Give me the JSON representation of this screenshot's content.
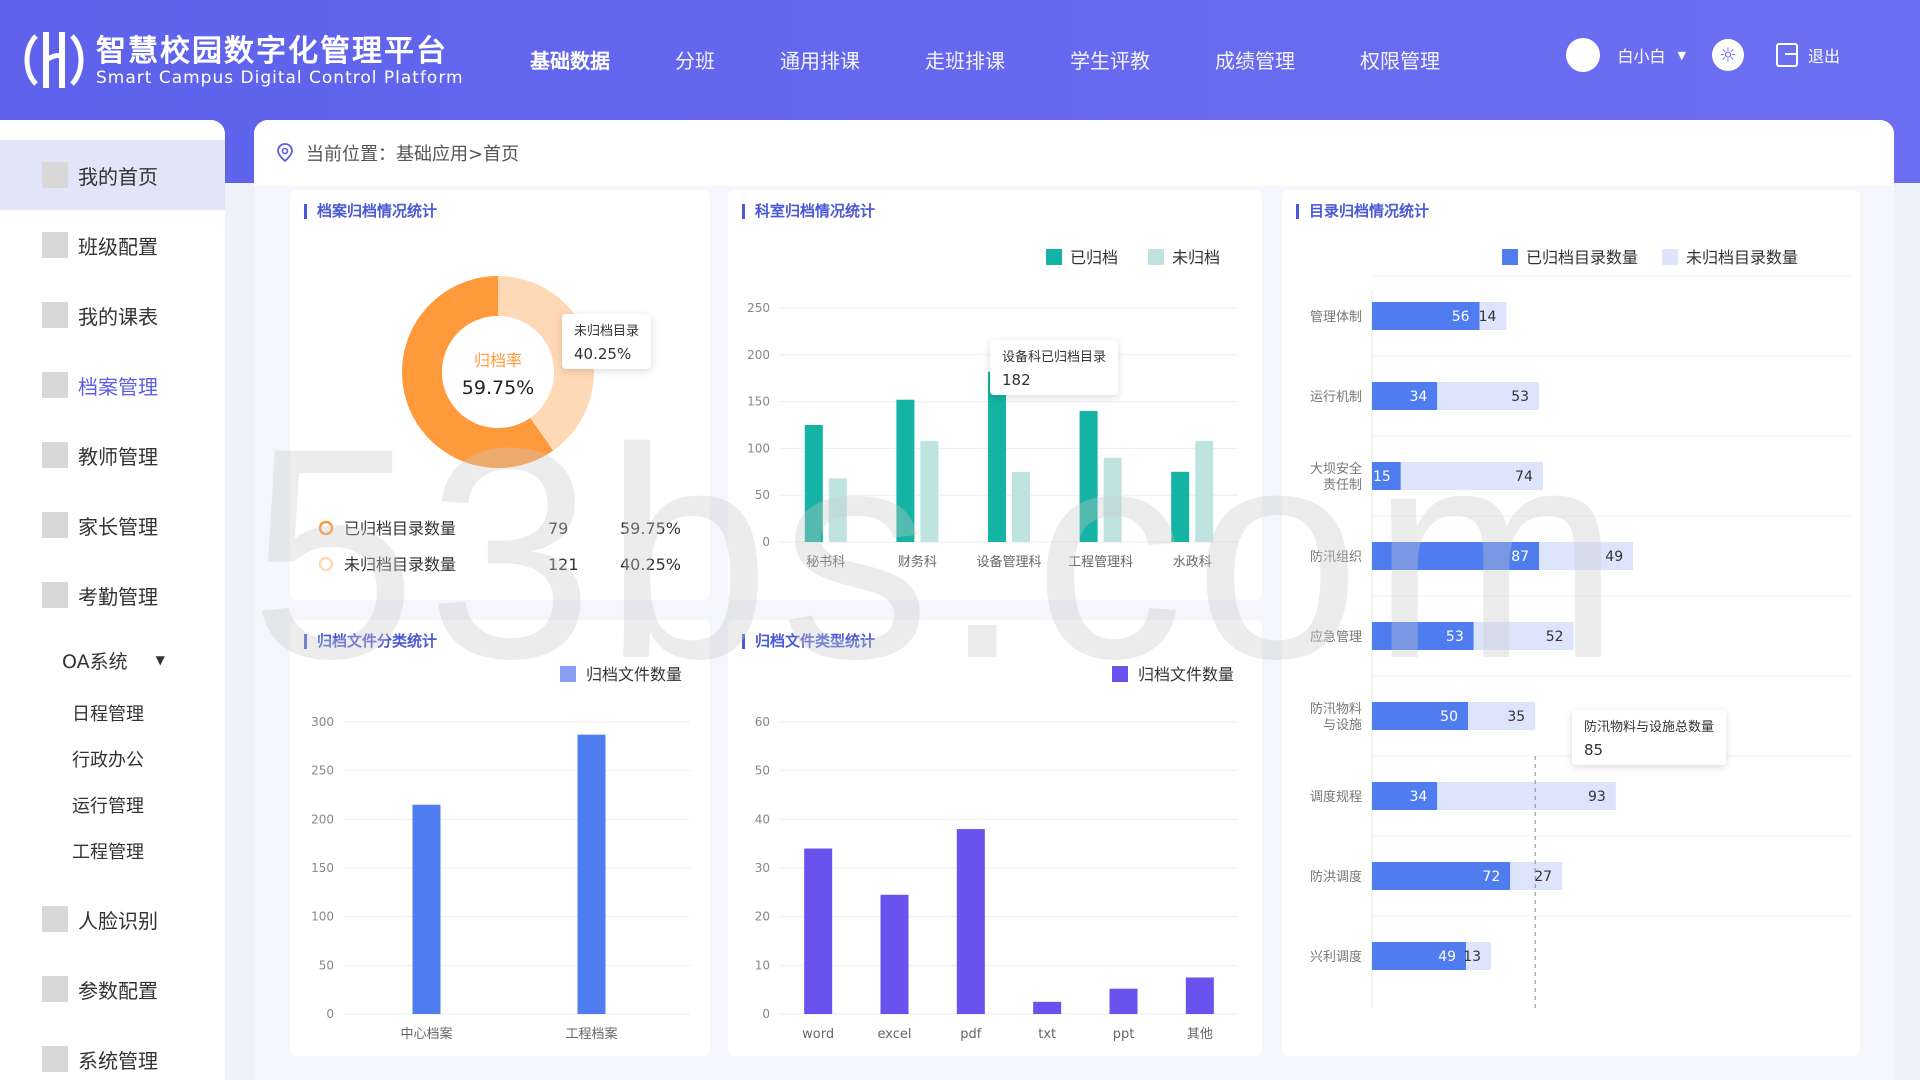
{
  "brand": {
    "cn": "智慧校园数字化管理平台",
    "en": "Smart Campus Digital Control Platform"
  },
  "nav": [
    {
      "label": "基础数据",
      "active": true
    },
    {
      "label": "分班"
    },
    {
      "label": "通用排课"
    },
    {
      "label": "走班排课"
    },
    {
      "label": "学生评教"
    },
    {
      "label": "成绩管理"
    },
    {
      "label": "权限管理"
    }
  ],
  "user": {
    "name": "白小白",
    "logout": "退出"
  },
  "sidebar": {
    "items": [
      "我的首页",
      "班级配置",
      "我的课表",
      "档案管理",
      "教师管理",
      "家长管理",
      "考勤管理"
    ],
    "oa": {
      "label": "OA系统",
      "children": [
        "日程管理",
        "行政办公",
        "运行管理",
        "工程管理"
      ]
    },
    "items2": [
      "人脸识别",
      "参数配置",
      "系统管理"
    ]
  },
  "breadcrumb": "当前位置：基础应用>首页",
  "colors": {
    "orange": "#ff9a3c",
    "lightOrange": "#ffd9b5",
    "teal": "#14b3a3",
    "lightTeal": "#bfe3e1",
    "blue": "#4f7df0",
    "lightBlue": "#dde5fc",
    "purple": "#6a52ee"
  },
  "card1": {
    "title": "档案归档情况统计",
    "center_label": "归档率",
    "center_value": "59.75%",
    "tooltip": {
      "label": "未归档目录",
      "value": "40.25%"
    },
    "legend": [
      {
        "name": "已归档目录数量",
        "count": "79",
        "pct": "59.75%"
      },
      {
        "name": "未归档目录数量",
        "count": "121",
        "pct": "40.25%"
      }
    ]
  },
  "card2": {
    "title": "科室归档情况统计",
    "legend": [
      "已归档",
      "未归档"
    ],
    "tooltip": {
      "label": "设备科已归档目录",
      "value": "182"
    }
  },
  "card3": {
    "title": "目录归档情况统计",
    "legend": [
      "已归档目录数量",
      "未归档目录数量"
    ],
    "tooltip": {
      "label": "防汛物料与设施总数量",
      "value": "85"
    }
  },
  "card4": {
    "title": "归档文件分类统计",
    "legend": [
      "归档文件数量"
    ]
  },
  "card5": {
    "title": "归档文件类型统计",
    "legend": [
      "归档文件数量"
    ]
  },
  "watermark": "53bs.com",
  "chart_data": [
    {
      "type": "pie",
      "title": "档案归档情况统计",
      "values": [
        59.75,
        40.25
      ],
      "labels": [
        "已归档目录数量",
        "未归档目录数量"
      ]
    },
    {
      "type": "bar",
      "title": "科室归档情况统计",
      "categories": [
        "秘书科",
        "财务科",
        "设备管理科",
        "工程管理科",
        "水政科"
      ],
      "ylim": [
        0,
        250
      ],
      "yticks": [
        "250",
        "200",
        "150",
        "100",
        "50",
        "0"
      ],
      "series": [
        {
          "name": "已归档",
          "values": [
            125,
            152,
            182,
            140,
            75
          ]
        },
        {
          "name": "未归档",
          "values": [
            68,
            108,
            75,
            90,
            108
          ]
        }
      ]
    },
    {
      "type": "bar",
      "title": "目录归档情况统计",
      "orientation": "horizontal",
      "categories": [
        "管理体制",
        "运行机制",
        "大坝安全责任制",
        "防汛组织",
        "应急管理",
        "防汛物料与设施",
        "调度规程",
        "防洪调度",
        "兴利调度"
      ],
      "category_labels": [
        [
          "管理体制"
        ],
        [
          "运行机制"
        ],
        [
          "大坝安全",
          "责任制"
        ],
        [
          "防汛组织"
        ],
        [
          "应急管理"
        ],
        [
          "防汛物料",
          "与设施"
        ],
        [
          "调度规程"
        ],
        [
          "防洪调度"
        ],
        [
          "兴利调度"
        ]
      ],
      "series": [
        {
          "name": "已归档目录数量",
          "values": [
            56,
            34,
            15,
            87,
            53,
            50,
            34,
            72,
            49
          ]
        },
        {
          "name": "未归档目录数量",
          "values": [
            14,
            53,
            74,
            49,
            52,
            35,
            93,
            27,
            13
          ]
        }
      ],
      "xlim": [
        0,
        250
      ]
    },
    {
      "type": "bar",
      "title": "归档文件分类统计",
      "categories": [
        "中心档案",
        "工程档案"
      ],
      "ylim": [
        0,
        300
      ],
      "yticks": [
        "300",
        "250",
        "200",
        "150",
        "100",
        "50",
        "0"
      ],
      "series": [
        {
          "name": "归档文件数量",
          "values": [
            215,
            287
          ]
        }
      ]
    },
    {
      "type": "bar",
      "title": "归档文件类型统计",
      "categories": [
        "word",
        "excel",
        "pdf",
        "txt",
        "ppt",
        "其他"
      ],
      "ylim": [
        0,
        60
      ],
      "yticks": [
        "60",
        "50",
        "40",
        "30",
        "20",
        "10",
        "0"
      ],
      "series": [
        {
          "name": "归档文件数量",
          "values": [
            34,
            24.5,
            38,
            2.5,
            5.2,
            7.5
          ]
        }
      ]
    }
  ]
}
